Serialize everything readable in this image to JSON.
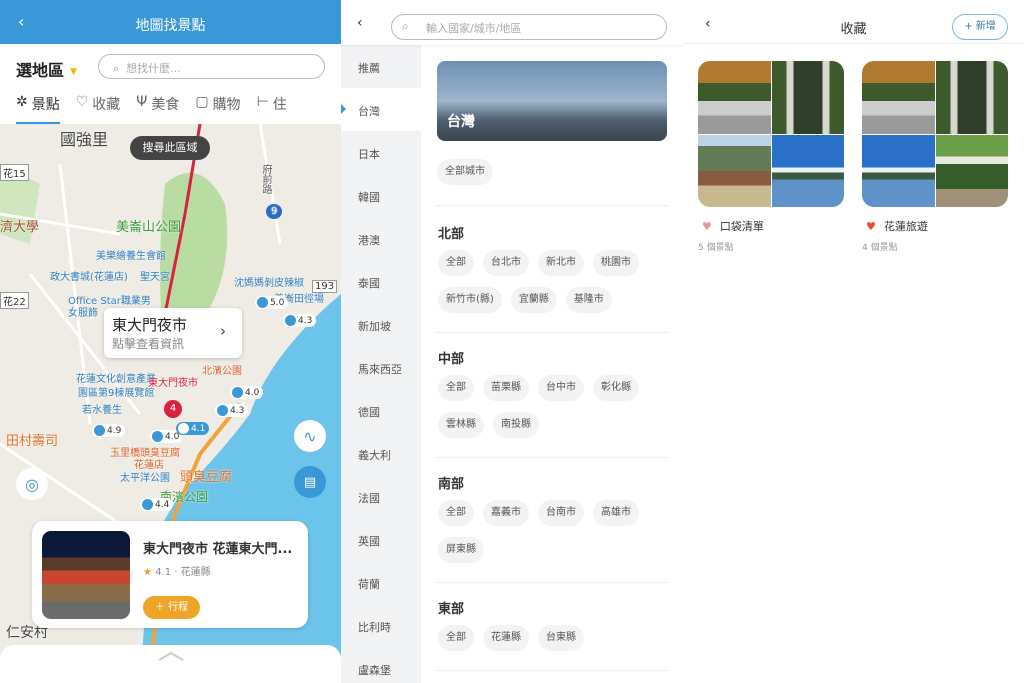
{
  "map_screen": {
    "header": {
      "back": "‹",
      "title": "地圖找景點"
    },
    "region_label": "選地區",
    "search_placeholder": "想找什麼...",
    "tabs": [
      {
        "label": "景點",
        "icon": "attraction-icon",
        "active": true
      },
      {
        "label": "收藏",
        "icon": "heart-icon"
      },
      {
        "label": "美食",
        "icon": "fork-knife-icon"
      },
      {
        "label": "購物",
        "icon": "shopping-bag-icon"
      },
      {
        "label": "住",
        "icon": "bed-icon"
      }
    ],
    "search_area_button": "搜尋此區域",
    "map_labels": [
      "國強里",
      "府前路",
      "美崙山公園",
      "濟大學",
      "美樂繪養生會館",
      "政大書城(花蓮店)",
      "聖天宮",
      "沈媽媽剝皮辣椒",
      "美崙田徑場",
      "Office Star職業男",
      "女服飾",
      "花蓮文化創意產業",
      "園區第9棟展覽館",
      "東大門夜市",
      "北濱公園",
      "若水養生",
      "田村壽司",
      "玉里橋頭臭豆腐",
      "花蓮店",
      "太平洋公園",
      "頭臭豆腐",
      "南濱公園",
      "仁安村",
      "花15",
      "花22",
      "193",
      "9"
    ],
    "ratings": [
      "5.0",
      "4.3",
      "4.3",
      "4.9",
      "4.0",
      "4.1",
      "4.4",
      "4.0"
    ],
    "cluster_count": "4",
    "popup": {
      "title": "東大門夜市",
      "subtitle": "點擊查看資訊"
    },
    "place_card": {
      "name": "東大門夜市 花蓮東大門...",
      "rating": "4.1",
      "location": "花蓮縣",
      "add_button": "行程"
    },
    "colors": {
      "header": "#3a98d8",
      "accent_button": "#eea527",
      "route": "#d8223f"
    }
  },
  "region_screen": {
    "search_placeholder": "輸入國家/城市/地區",
    "countries": [
      "推薦",
      "台灣",
      "日本",
      "韓國",
      "港澳",
      "泰國",
      "新加坡",
      "馬來西亞",
      "德國",
      "義大利",
      "法國",
      "英國",
      "荷蘭",
      "比利時",
      "盧森堡"
    ],
    "active_country": "台灣",
    "hero_title": "台灣",
    "all_cities": "全部城市",
    "sections": [
      {
        "title": "北部",
        "chips": [
          "全部",
          "台北市",
          "新北市",
          "桃園市",
          "新竹市(縣)",
          "宜蘭縣",
          "基隆市"
        ]
      },
      {
        "title": "中部",
        "chips": [
          "全部",
          "苗栗縣",
          "台中市",
          "彰化縣",
          "雲林縣",
          "南投縣"
        ]
      },
      {
        "title": "南部",
        "chips": [
          "全部",
          "嘉義市",
          "台南市",
          "高雄市",
          "屏東縣"
        ]
      },
      {
        "title": "東部",
        "chips": [
          "全部",
          "花蓮縣",
          "台東縣"
        ]
      }
    ]
  },
  "favorites_screen": {
    "title": "收藏",
    "new_button": "+ 新增",
    "collections": [
      {
        "name": "口袋清單",
        "count": "5 個景點",
        "heart_color": "#e39a9a"
      },
      {
        "name": "花蓮旅遊",
        "count": "4 個景點",
        "heart_color": "#e0502a"
      }
    ]
  }
}
